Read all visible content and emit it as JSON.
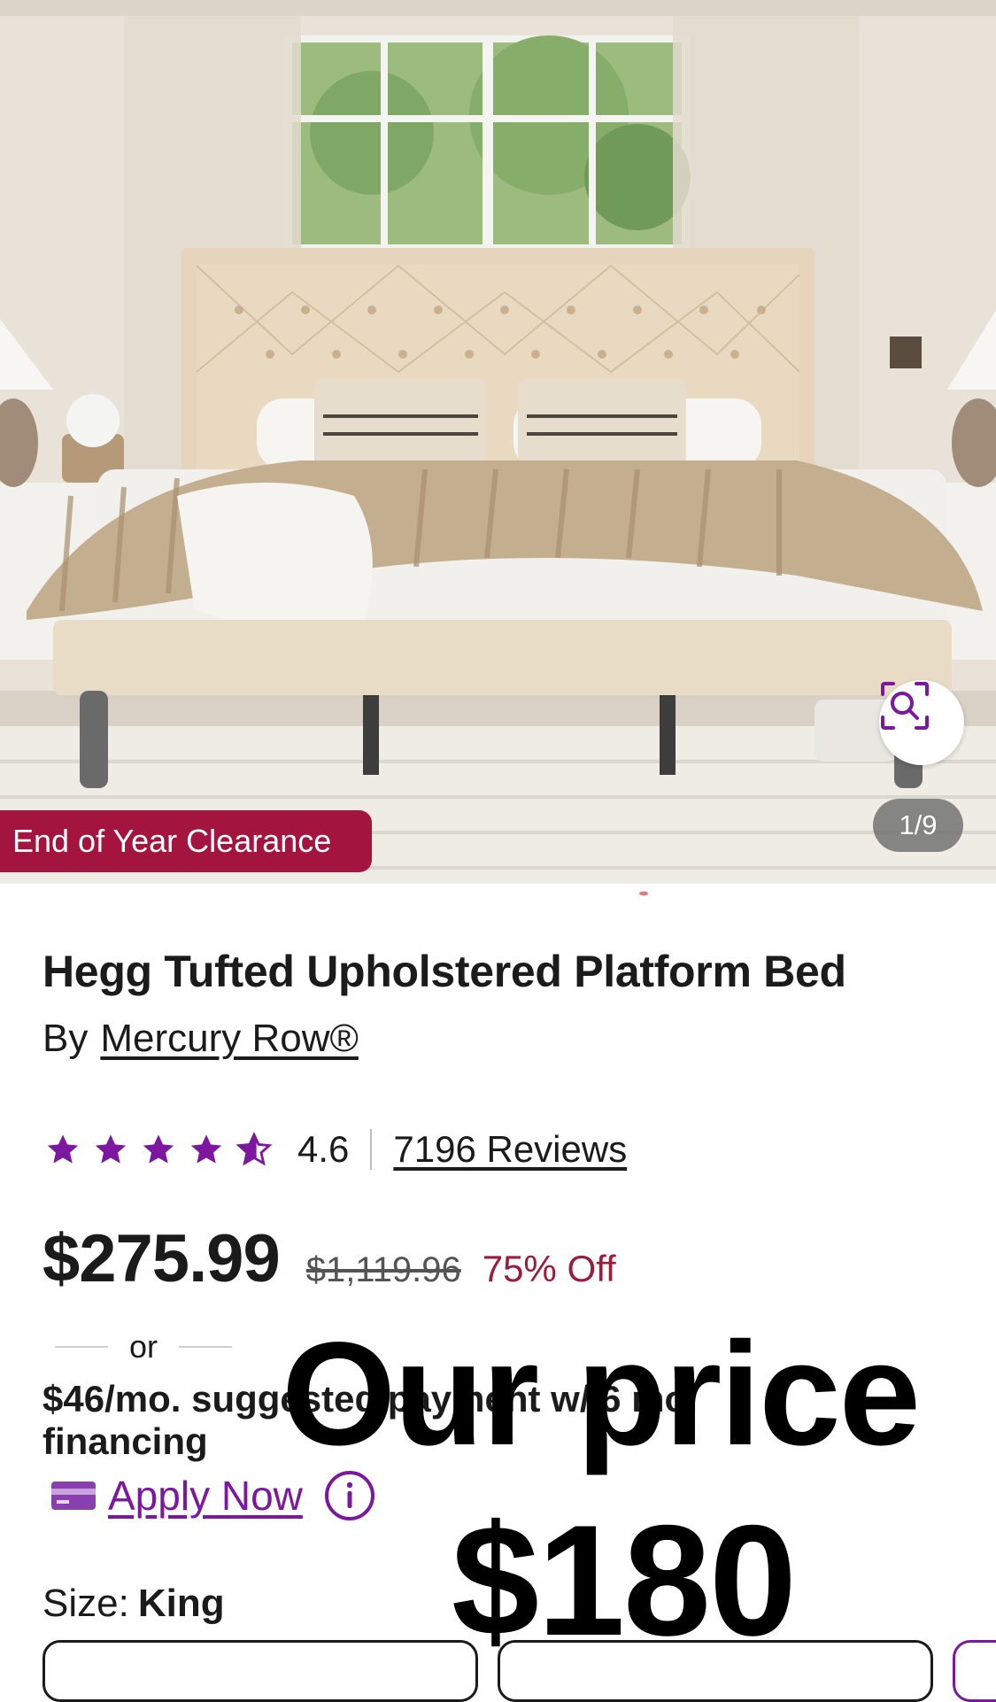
{
  "hero": {
    "image_counter": "1/9",
    "badge": "End of Year Clearance",
    "zoom_icon": "image-search-icon"
  },
  "product": {
    "title": "Hegg Tufted Upholstered Platform Bed",
    "by_label": "By",
    "brand": "Mercury Row®",
    "rating_value": "4.6",
    "rating_stars": 4.6,
    "reviews": "7196 Reviews",
    "price": "$275.99",
    "original_price": "$1,119.96",
    "discount": "75% Off",
    "or_label": "or",
    "financing": "$46/mo. suggested payment w/ 6 mo. financing",
    "apply_now": "Apply Now",
    "size_label": "Size:",
    "size_value": "King"
  },
  "overlay": {
    "line1": "Our price",
    "line2": "$180"
  },
  "colors": {
    "star": "#7b189f",
    "badge": "#a3143e",
    "discount": "#9b1c3c",
    "link": "#7b189f"
  }
}
